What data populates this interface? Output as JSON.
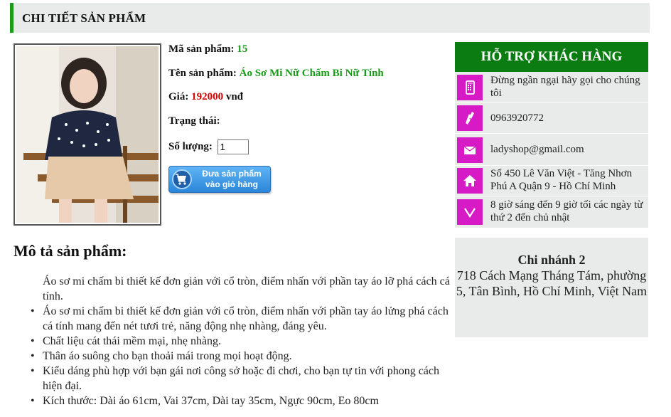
{
  "header": {
    "title": "CHI TIẾT SẢN PHẨM"
  },
  "product": {
    "code_label": "Mã sản phẩm:",
    "code_value": "15",
    "name_label": "Tên sản phẩm:",
    "name_value": "Áo Sơ Mi Nữ Chấm Bi Nữ Tính",
    "price_label": "Giá:",
    "price_value": "192000",
    "price_unit": "vnđ",
    "status_label": "Trạng thái:",
    "quantity_label": "Số lượng:",
    "quantity_value": "1",
    "cart_button_line1": "Đưa sản phẩm",
    "cart_button_line2": "vào giỏ hàng"
  },
  "description": {
    "title": "Mô tả sản phẩm:",
    "intro": "Áo sơ mi chấm bi thiết kế đơn giản với cổ tròn, điểm nhấn với phần tay áo lỡ phá cách cá tính.",
    "bullets": [
      "Áo sơ mi chấm bi thiết kế đơn giản với cổ tròn, điểm nhấn với phần tay áo lửng phá cách cá tính mang đến nét tươi trẻ, năng động nhẹ nhàng, đáng yêu.",
      "Chất liệu cát thái mềm mại, nhẹ nhàng.",
      "Thân áo suông cho bạn thoải mái trong mọi hoạt động.",
      "Kiểu dáng phù hợp với bạn gái nơi công sở hoặc đi chơi, cho bạn tự tin với phong cách hiện đại.",
      "Kích thước: Dài áo 61cm, Vai 37cm, Dài tay 35cm, Ngực 90cm, Eo 80cm"
    ]
  },
  "support": {
    "title": "HỖ TRỢ KHÁC HÀNG",
    "items": [
      {
        "icon": "mobile-phone-icon",
        "text": "Đừng ngần ngại hãy gọi cho chúng tôi"
      },
      {
        "icon": "phone-handset-icon",
        "text": "0963920772"
      },
      {
        "icon": "envelope-icon",
        "text": "ladyshop@gmail.com"
      },
      {
        "icon": "home-icon",
        "text": "Số 450 Lê Văn Việt - Tăng Nhơn Phú A Quận 9 - Hồ Chí Minh"
      },
      {
        "icon": "clock-chevron-icon",
        "text": "8 giờ sáng đến 9 giờ tối các ngày từ thứ 2 đến chủ nhật"
      }
    ]
  },
  "branch": {
    "title": "Chi nhánh 2",
    "address": "718 Cách Mạng Tháng Tám, phường 5, Tân Bình, Hồ Chí Minh, Việt Nam"
  },
  "colors": {
    "accent_green": "#0b7c12",
    "link_green": "#1a9a1a",
    "price_red": "#d40000",
    "icon_magenta": "#d61ac6",
    "panel_gray": "#e9ebea"
  }
}
